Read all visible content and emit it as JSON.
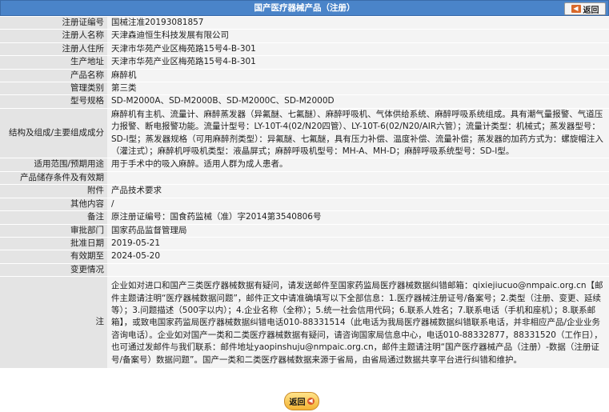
{
  "header": {
    "title": "国产医疗器械产品（注册）",
    "back_label": "返回"
  },
  "rows": [
    {
      "label": "注册证编号",
      "value": "国械注准20193081857"
    },
    {
      "label": "注册人名称",
      "value": "天津森迪恒生科技发展有限公司"
    },
    {
      "label": "注册人住所",
      "value": "天津市华苑产业区梅苑路15号4-B-301"
    },
    {
      "label": "生产地址",
      "value": "天津市华苑产业区梅苑路15号4-B-301"
    },
    {
      "label": "产品名称",
      "value": "麻醉机"
    },
    {
      "label": "管理类别",
      "value": "第三类"
    },
    {
      "label": "型号规格",
      "value": "SD-M2000A、SD-M2000B、SD-M2000C、SD-M2000D"
    },
    {
      "label": "结构及组成/主要组成成分",
      "value": "麻醉机有主机、流量计、麻醉蒸发器（异氟醚、七氟醚）、麻醉呼吸机、气体供给系统、麻醉呼吸系统组成。具有潮气量报警、气道压力报警、断电报警功能。流量计型号：LY-10T-4(02/N20四管）、LY-10T-6(02/N20/AIR六管）；流量计类型：机械式；蒸发器型号：SD-I型；蒸发器规格（可用麻醉剂类型）：异氟醚、七氟醚，具有压力补偿、温度补偿、流量补偿；蒸发器的加药方式为：螺旋帽注入（灌注式）；麻醉机呼吸机类型：液晶屏式；麻醉呼吸机型号：MH-A、MH-D；麻醉呼吸系统型号：SD-I型。"
    },
    {
      "label": "适用范围/预期用途",
      "value": "用于手术中的吸入麻醉。适用人群为成人患者。"
    },
    {
      "label": "产品储存条件及有效期",
      "value": ""
    },
    {
      "label": "附件",
      "value": "产品技术要求"
    },
    {
      "label": "其他内容",
      "value": "/"
    },
    {
      "label": "备注",
      "value": "原注册证编号：国食药监械（准）字2014第3540806号"
    },
    {
      "label": "审批部门",
      "value": "国家药品监督管理局"
    },
    {
      "label": "批准日期",
      "value": "2019-05-21"
    },
    {
      "label": "有效期至",
      "value": "2024-05-20"
    },
    {
      "label": "变更情况",
      "value": ""
    },
    {
      "label": "注",
      "value": "企业如对进口和国产三类医疗器械数据有疑问，请发送邮件至国家药监局医疗器械数据纠错邮箱：qixiejiucuo@nmpaic.org.cn【邮件主题请注明“医疗器械数据问题”，邮件正文中请准确填写以下全部信息：1.医疗器械注册证号/备案号；2.类型（注册、变更、延续等）；3.问题描述（500字以内）；4.企业名称（全称）；5.统一社会信用代码；6.联系人姓名；7.联系电话（手机和座机）；8.联系邮箱】，或致电国家药监局医疗器械数据纠错电话010-88331514（此电话为我局医疗器械数据纠错联系电话，并非相应产品/企业业务咨询电话）。企业如对国产一类和二类医疗器械数据有疑问，请咨询国家局信息中心，电话010-88332877，88331520（工作日），也可通过发邮件与我们联系：邮件地址yaopinshuju@nmpaic.org.cn，邮件主题请注明“国产医疗器械产品（注册）-数据（注册证号/备案号）数据问题”。国产一类和二类医疗器械数据来源于省局，由省局通过数据共享平台进行纠错和维护。"
    }
  ],
  "footer": {
    "back_label": "返回"
  }
}
